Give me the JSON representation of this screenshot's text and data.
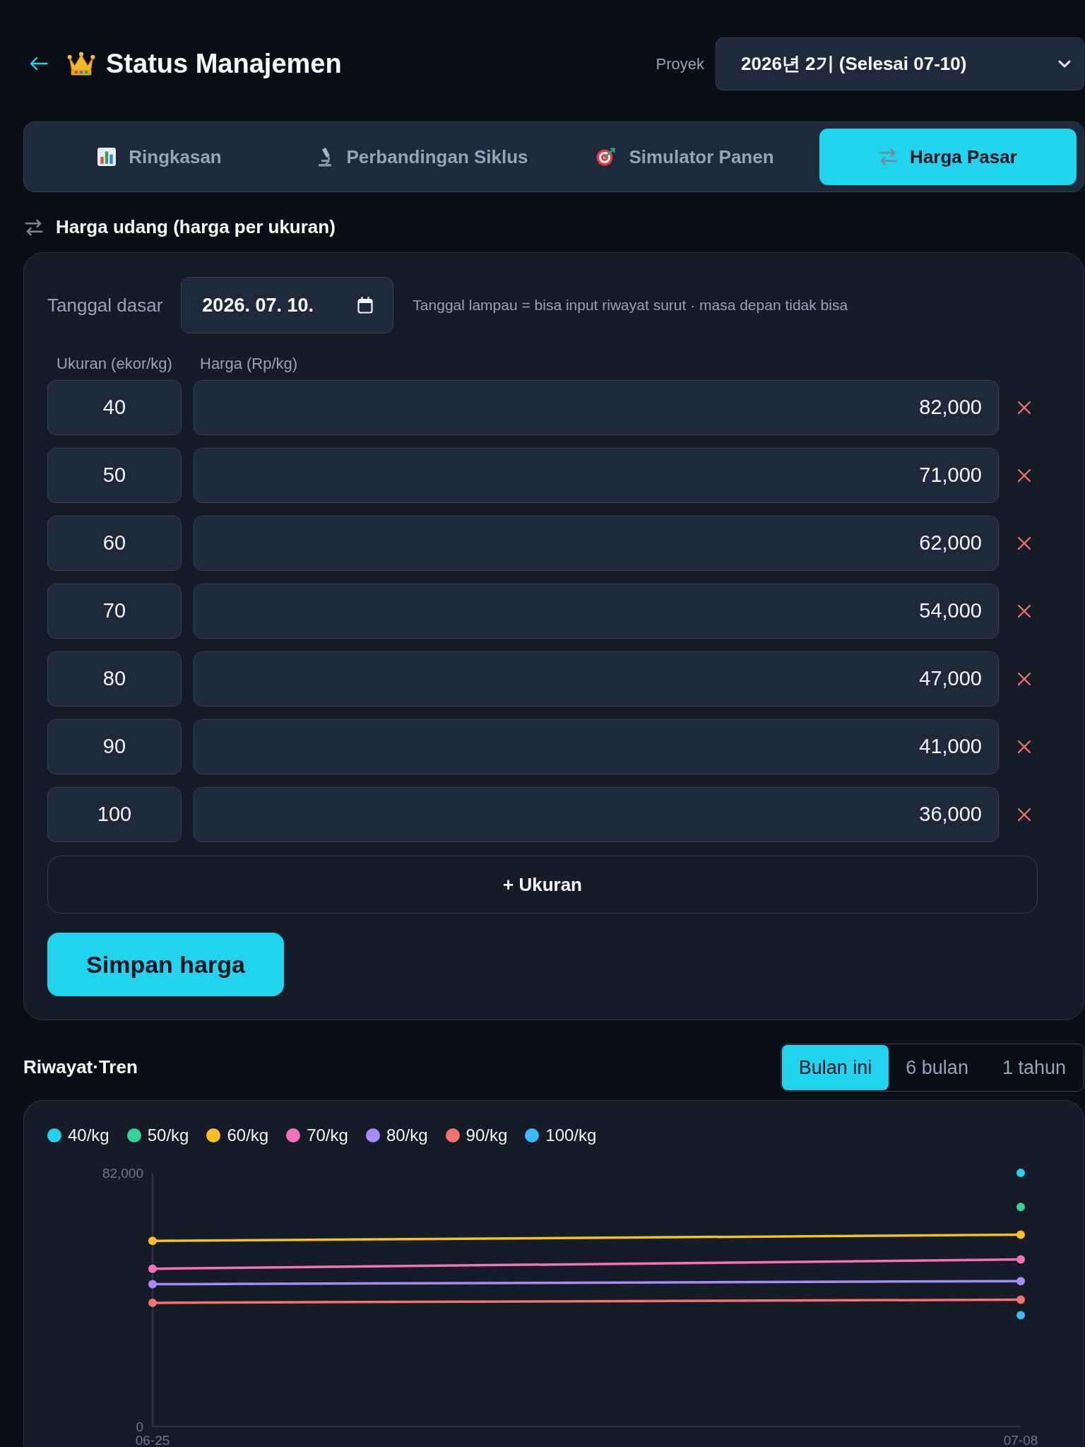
{
  "header": {
    "title": "Status Manajemen",
    "project_label": "Proyek",
    "project_value": "2026년 2기 (Selesai 07-10)"
  },
  "tabs": [
    {
      "label": "Ringkasan",
      "selected": false
    },
    {
      "label": "Perbandingan Siklus",
      "selected": false
    },
    {
      "label": "Simulator Panen",
      "selected": false
    },
    {
      "label": "Harga Pasar",
      "selected": true
    }
  ],
  "price_section": {
    "title": "Harga udang (harga per ukuran)",
    "date_label": "Tanggal dasar",
    "date_value": "2026. 07. 10.",
    "date_hint": "Tanggal lampau = bisa input riwayat surut · masa depan tidak bisa",
    "columns": [
      "Ukuran (ekor/kg)",
      "Harga (Rp/kg)"
    ],
    "rows": [
      {
        "size": "40",
        "price": "82,000"
      },
      {
        "size": "50",
        "price": "71,000"
      },
      {
        "size": "60",
        "price": "62,000"
      },
      {
        "size": "70",
        "price": "54,000"
      },
      {
        "size": "80",
        "price": "47,000"
      },
      {
        "size": "90",
        "price": "41,000"
      },
      {
        "size": "100",
        "price": "36,000"
      }
    ],
    "add_button": "+ Ukuran",
    "save_button": "Simpan harga"
  },
  "history": {
    "title": "Riwayat·Tren",
    "ranges": [
      {
        "label": "Bulan ini",
        "selected": true
      },
      {
        "label": "6 bulan",
        "selected": false
      },
      {
        "label": "1 tahun",
        "selected": false
      }
    ],
    "chart_data": {
      "type": "line",
      "categories": [
        "06-25",
        "07-08"
      ],
      "series": [
        {
          "name": "40/kg",
          "color": "#22d3ee",
          "marker": "circle",
          "values": [
            null,
            82000
          ]
        },
        {
          "name": "50/kg",
          "color": "#34d399",
          "marker": "circle",
          "values": [
            null,
            71000
          ]
        },
        {
          "name": "60/kg",
          "color": "#fbbf24",
          "marker": "circle",
          "values": [
            60000,
            62000
          ]
        },
        {
          "name": "70/kg",
          "color": "#f472b6",
          "marker": "circle",
          "values": [
            51000,
            54000
          ]
        },
        {
          "name": "80/kg",
          "color": "#a78bfa",
          "marker": "circle",
          "values": [
            46000,
            47000
          ]
        },
        {
          "name": "90/kg",
          "color": "#f87171",
          "marker": "circle",
          "values": [
            40000,
            41000
          ]
        },
        {
          "name": "100/kg",
          "color": "#38bdf8",
          "marker": "circle",
          "values": [
            null,
            36000
          ]
        }
      ],
      "ylim": [
        0,
        82000
      ],
      "yticks": [
        {
          "value": 0,
          "label": "0"
        },
        {
          "value": 82000,
          "label": "82,000"
        }
      ]
    }
  }
}
